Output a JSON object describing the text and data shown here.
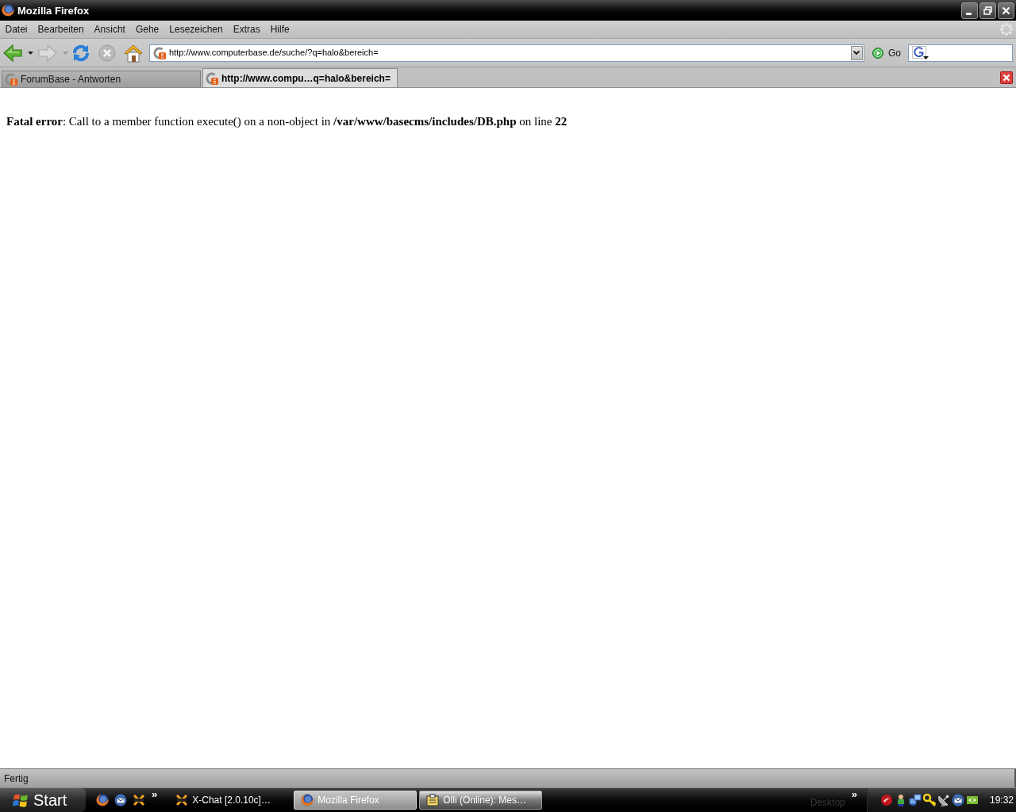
{
  "window": {
    "title": "Mozilla Firefox"
  },
  "menu_bar": [
    "Datei",
    "Bearbeiten",
    "Ansicht",
    "Gehe",
    "Lesezeichen",
    "Extras",
    "Hilfe"
  ],
  "navigation_toolbar": {
    "buttons": [
      {
        "kind": "back",
        "disabled": false
      },
      {
        "kind": "forward",
        "disabled": true
      },
      {
        "kind": "reload",
        "disabled": false
      },
      {
        "kind": "stop",
        "disabled": true
      },
      {
        "kind": "home",
        "disabled": false
      }
    ],
    "address": "http://www.computerbase.de/suche/?q=halo&bereich=",
    "go_label": "Go"
  },
  "tabs": [
    {
      "label": "ForumBase - Antworten",
      "selected": false
    },
    {
      "label": "http://www.compu…q=halo&bereich=",
      "selected": true
    }
  ],
  "page": {
    "error_message": "**Fatal error**: Call to a member function execute() on a non-object in **/var/www/basecms/includes/DB.php** on line **22**"
  },
  "status_bar": {
    "text": "Fertig"
  },
  "taskbar": {
    "start_label": "Start",
    "quick_launch_more": "»",
    "windows": [
      {
        "kind": "chat",
        "label": "X-Chat [2.0.10c]…",
        "selected": false,
        "highlighted": false
      },
      {
        "kind": "browser",
        "label": "Mozilla Firefox",
        "selected": true,
        "highlighted": false
      },
      {
        "kind": "messenger",
        "label": "Olli (Online): Mes…",
        "selected": false,
        "highlighted": true
      }
    ],
    "desktop_label": "Desktop",
    "desktop_more": "»",
    "clock": "19:32"
  }
}
